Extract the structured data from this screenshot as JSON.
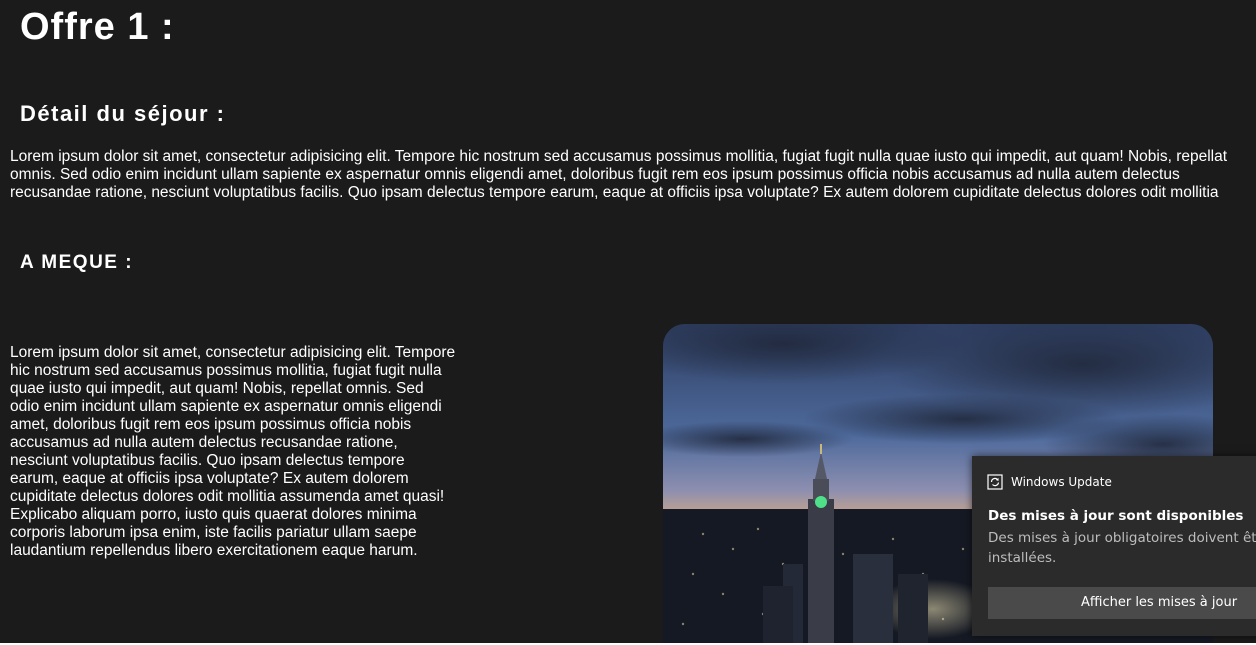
{
  "offer": {
    "title": "Offre 1 :"
  },
  "detail": {
    "heading": "Détail du séjour :",
    "lines": [
      "Lorem ipsum dolor sit amet, consectetur adipisicing elit. Tempore hic nostrum sed accusamus possimus mollitia, fugiat fugit nulla quae iusto qui impedit, aut quam! Nobis, repellat",
      "omnis. Sed odio enim incidunt ullam sapiente ex aspernatur omnis eligendi amet, doloribus fugit rem eos ipsum possimus officia nobis accusamus ad nulla autem delectus",
      "recusandae ratione, nesciunt voluptatibus facilis. Quo ipsam delectus tempore earum, eaque at officiis ipsa voluptate? Ex autem dolorem cupiditate delectus dolores odit mollitia"
    ]
  },
  "meque": {
    "heading": "A MEQUE :",
    "lines": [
      "Lorem ipsum dolor sit amet, consectetur adipisicing elit. Tempore",
      "hic nostrum sed accusamus possimus mollitia, fugiat fugit nulla",
      "quae iusto qui impedit, aut quam! Nobis, repellat omnis. Sed",
      "odio enim incidunt ullam sapiente ex aspernatur omnis eligendi",
      "amet, doloribus fugit rem eos ipsum possimus officia nobis",
      "accusamus ad nulla autem delectus recusandae ratione,",
      "nesciunt voluptatibus facilis. Quo ipsam delectus tempore",
      "earum, eaque at officiis ipsa voluptate? Ex autem dolorem",
      "cupiditate delectus dolores odit mollitia assumenda amet quasi!",
      "Explicabo aliquam porro, iusto quis quaerat dolores minima",
      "corporis laborum ipsa enim, iste facilis pariatur ullam saepe",
      "laudantium repellendus libero exercitationem eaque harum."
    ]
  },
  "notification": {
    "app_name": "Windows Update",
    "app_icon": "update-icon",
    "title": "Des mises à jour sont disponibles",
    "body": "Des mises à jour obligatoires doivent être installées.",
    "button_label": "Afficher les mises à jour"
  },
  "colors": {
    "page_background": "#1b1b1b",
    "text": "#ffffff",
    "toast_background": "#2b2b2b",
    "toast_button": "#4a4a4a"
  }
}
